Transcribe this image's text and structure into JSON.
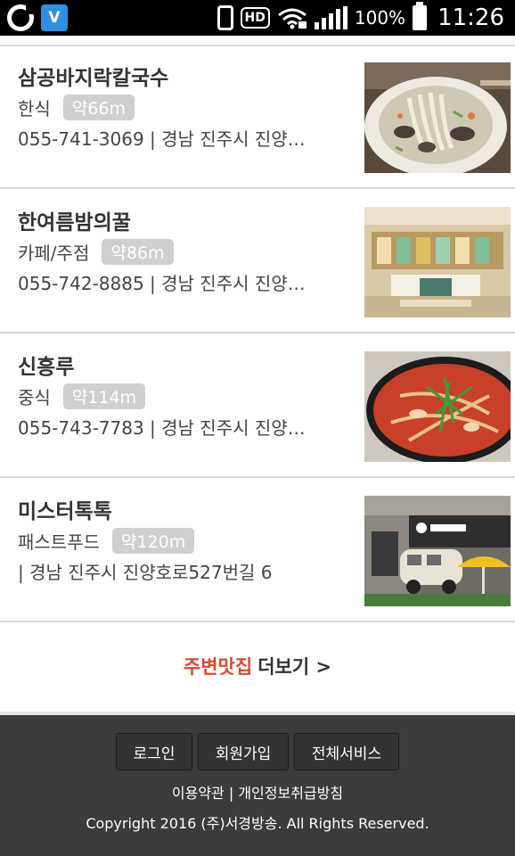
{
  "status_bar": {
    "hd_label": "HD",
    "battery_text": "100%",
    "time": "11:26",
    "app_v_label": "V"
  },
  "restaurants": [
    {
      "name": "삼공바지락칼국수",
      "category": "한식",
      "distance": "약66m",
      "info": "055-741-3069 | 경남 진주시 진양…",
      "thumb": "noodle-soup-photo"
    },
    {
      "name": "한여름밤의꿀",
      "category": "카페/주점",
      "distance": "약86m",
      "info": "055-742-8885 | 경남 진주시 진양…",
      "thumb": "cafe-interior-photo"
    },
    {
      "name": "신흥루",
      "category": "중식",
      "distance": "약114m",
      "info": "055-743-7783 | 경남 진주시 진양…",
      "thumb": "jjamppong-photo"
    },
    {
      "name": "미스터톡톡",
      "category": "패스트푸드",
      "distance": "약120m",
      "info": "| 경남 진주시 진양호로527번길 6",
      "thumb": "storefront-photo"
    }
  ],
  "more": {
    "accent": "주변맛집",
    "rest": "더보기 >"
  },
  "footer": {
    "buttons": [
      "로그인",
      "회원가입",
      "전체서비스"
    ],
    "links": "이용약관 | 개인정보취급방침",
    "copyright": "Copyright 2016 (주)서경방송. All Rights Reserved."
  },
  "colors": {
    "accent": "#d9482f",
    "footer_bg": "#3b3b3b",
    "badge_bg": "#cfcfcf"
  }
}
